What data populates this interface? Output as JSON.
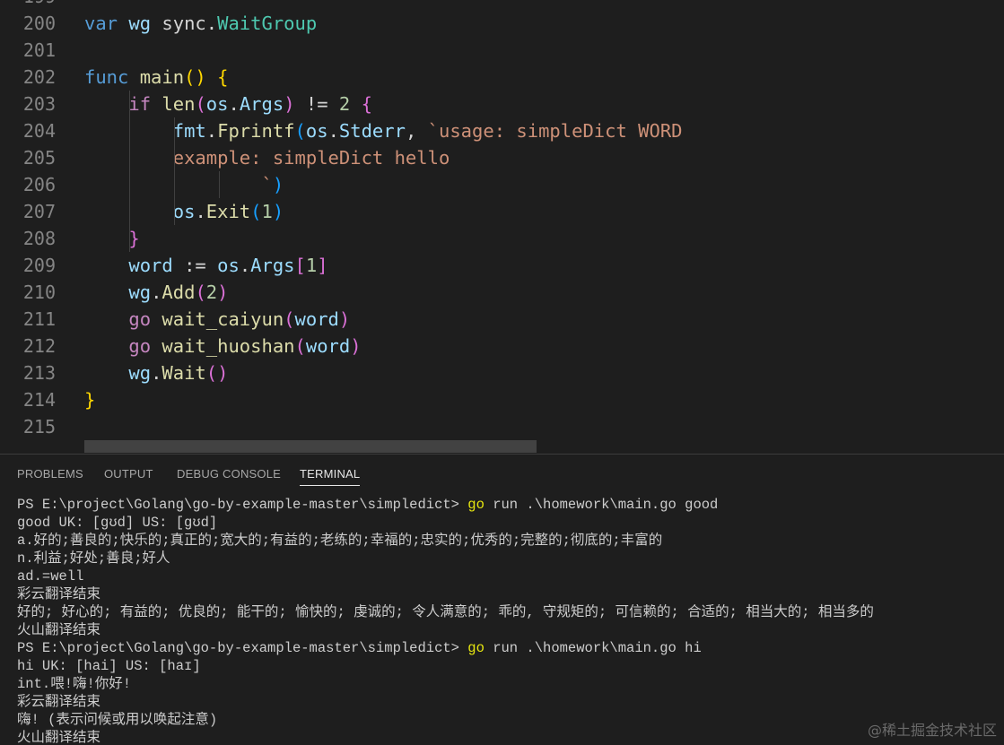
{
  "editor": {
    "partial_line_number": "199",
    "lines": [
      {
        "n": "200",
        "tokens": [
          {
            "t": "var",
            "c": "kw"
          },
          {
            "t": " "
          },
          {
            "t": "wg",
            "c": "var"
          },
          {
            "t": " sync."
          },
          {
            "t": "WaitGroup",
            "c": "ty"
          }
        ]
      },
      {
        "n": "201",
        "tokens": []
      },
      {
        "n": "202",
        "tokens": [
          {
            "t": "func",
            "c": "kw"
          },
          {
            "t": " "
          },
          {
            "t": "main",
            "c": "fn"
          },
          {
            "t": "()",
            "c": "p1"
          },
          {
            "t": " "
          },
          {
            "t": "{",
            "c": "p1"
          }
        ]
      },
      {
        "n": "203",
        "tokens": [
          {
            "t": "    "
          },
          {
            "t": "if",
            "c": "ctl"
          },
          {
            "t": " "
          },
          {
            "t": "len",
            "c": "fn"
          },
          {
            "t": "(",
            "c": "p2"
          },
          {
            "t": "os",
            "c": "var"
          },
          {
            "t": "."
          },
          {
            "t": "Args",
            "c": "var"
          },
          {
            "t": ")",
            "c": "p2"
          },
          {
            "t": " != "
          },
          {
            "t": "2",
            "c": "num"
          },
          {
            "t": " "
          },
          {
            "t": "{",
            "c": "p2"
          }
        ]
      },
      {
        "n": "204",
        "tokens": [
          {
            "t": "        "
          },
          {
            "t": "fmt",
            "c": "var"
          },
          {
            "t": "."
          },
          {
            "t": "Fprintf",
            "c": "fn"
          },
          {
            "t": "(",
            "c": "p3"
          },
          {
            "t": "os",
            "c": "var"
          },
          {
            "t": "."
          },
          {
            "t": "Stderr",
            "c": "var"
          },
          {
            "t": ", "
          },
          {
            "t": "`usage: simpleDict WORD",
            "c": "str"
          }
        ]
      },
      {
        "n": "205",
        "tokens": [
          {
            "t": "        "
          },
          {
            "t": "example: simpleDict hello",
            "c": "str"
          }
        ]
      },
      {
        "n": "206",
        "tokens": [
          {
            "t": "                "
          },
          {
            "t": "`",
            "c": "str"
          },
          {
            "t": ")",
            "c": "p3"
          }
        ]
      },
      {
        "n": "207",
        "tokens": [
          {
            "t": "        "
          },
          {
            "t": "os",
            "c": "var"
          },
          {
            "t": "."
          },
          {
            "t": "Exit",
            "c": "fn"
          },
          {
            "t": "(",
            "c": "p3"
          },
          {
            "t": "1",
            "c": "num"
          },
          {
            "t": ")",
            "c": "p3"
          }
        ]
      },
      {
        "n": "208",
        "tokens": [
          {
            "t": "    "
          },
          {
            "t": "}",
            "c": "p2"
          }
        ]
      },
      {
        "n": "209",
        "tokens": [
          {
            "t": "    "
          },
          {
            "t": "word",
            "c": "var"
          },
          {
            "t": " := "
          },
          {
            "t": "os",
            "c": "var"
          },
          {
            "t": "."
          },
          {
            "t": "Args",
            "c": "var"
          },
          {
            "t": "[",
            "c": "p2"
          },
          {
            "t": "1",
            "c": "num"
          },
          {
            "t": "]",
            "c": "p2"
          }
        ]
      },
      {
        "n": "210",
        "tokens": [
          {
            "t": "    "
          },
          {
            "t": "wg",
            "c": "var"
          },
          {
            "t": "."
          },
          {
            "t": "Add",
            "c": "fn"
          },
          {
            "t": "(",
            "c": "p2"
          },
          {
            "t": "2",
            "c": "num"
          },
          {
            "t": ")",
            "c": "p2"
          }
        ]
      },
      {
        "n": "211",
        "tokens": [
          {
            "t": "    "
          },
          {
            "t": "go",
            "c": "ctl"
          },
          {
            "t": " "
          },
          {
            "t": "wait_caiyun",
            "c": "fn"
          },
          {
            "t": "(",
            "c": "p2"
          },
          {
            "t": "word",
            "c": "var"
          },
          {
            "t": ")",
            "c": "p2"
          }
        ]
      },
      {
        "n": "212",
        "tokens": [
          {
            "t": "    "
          },
          {
            "t": "go",
            "c": "ctl"
          },
          {
            "t": " "
          },
          {
            "t": "wait_huoshan",
            "c": "fn"
          },
          {
            "t": "(",
            "c": "p2"
          },
          {
            "t": "word",
            "c": "var"
          },
          {
            "t": ")",
            "c": "p2"
          }
        ]
      },
      {
        "n": "213",
        "tokens": [
          {
            "t": "    "
          },
          {
            "t": "wg",
            "c": "var"
          },
          {
            "t": "."
          },
          {
            "t": "Wait",
            "c": "fn"
          },
          {
            "t": "()",
            "c": "p2"
          }
        ]
      },
      {
        "n": "214",
        "tokens": [
          {
            "t": "}",
            "c": "p1"
          }
        ]
      },
      {
        "n": "215",
        "tokens": []
      }
    ]
  },
  "panel": {
    "tabs": [
      {
        "label": "PROBLEMS",
        "active": false
      },
      {
        "label": "OUTPUT",
        "active": false
      },
      {
        "label": "DEBUG CONSOLE",
        "active": false
      },
      {
        "label": "TERMINAL",
        "active": true
      }
    ]
  },
  "terminal": {
    "lines": [
      {
        "prompt": "PS E:\\project\\Golang\\go-by-example-master\\simpledict> ",
        "cmd": "go",
        "rest": " run .\\homework\\main.go good"
      },
      {
        "text": "good UK: [gʊd] US: [gʊd]"
      },
      {
        "text": "a.好的;善良的;快乐的;真正的;宽大的;有益的;老练的;幸福的;忠实的;优秀的;完整的;彻底的;丰富的"
      },
      {
        "text": "n.利益;好处;善良;好人"
      },
      {
        "text": "ad.=well"
      },
      {
        "text": "彩云翻译结束"
      },
      {
        "text": "好的; 好心的; 有益的; 优良的; 能干的; 愉快的; 虔诚的; 令人满意的; 乖的, 守规矩的; 可信赖的; 合适的; 相当大的; 相当多的"
      },
      {
        "text": "火山翻译结束"
      },
      {
        "prompt": "PS E:\\project\\Golang\\go-by-example-master\\simpledict> ",
        "cmd": "go",
        "rest": " run .\\homework\\main.go hi"
      },
      {
        "text": "hi UK: [hai] US: [haɪ]"
      },
      {
        "text": "int.喂!嗨!你好!"
      },
      {
        "text": "彩云翻译结束"
      },
      {
        "text": "嗨! (表示问候或用以唤起注意)"
      },
      {
        "text": "火山翻译结束"
      }
    ]
  },
  "watermark": "@稀土掘金技术社区"
}
